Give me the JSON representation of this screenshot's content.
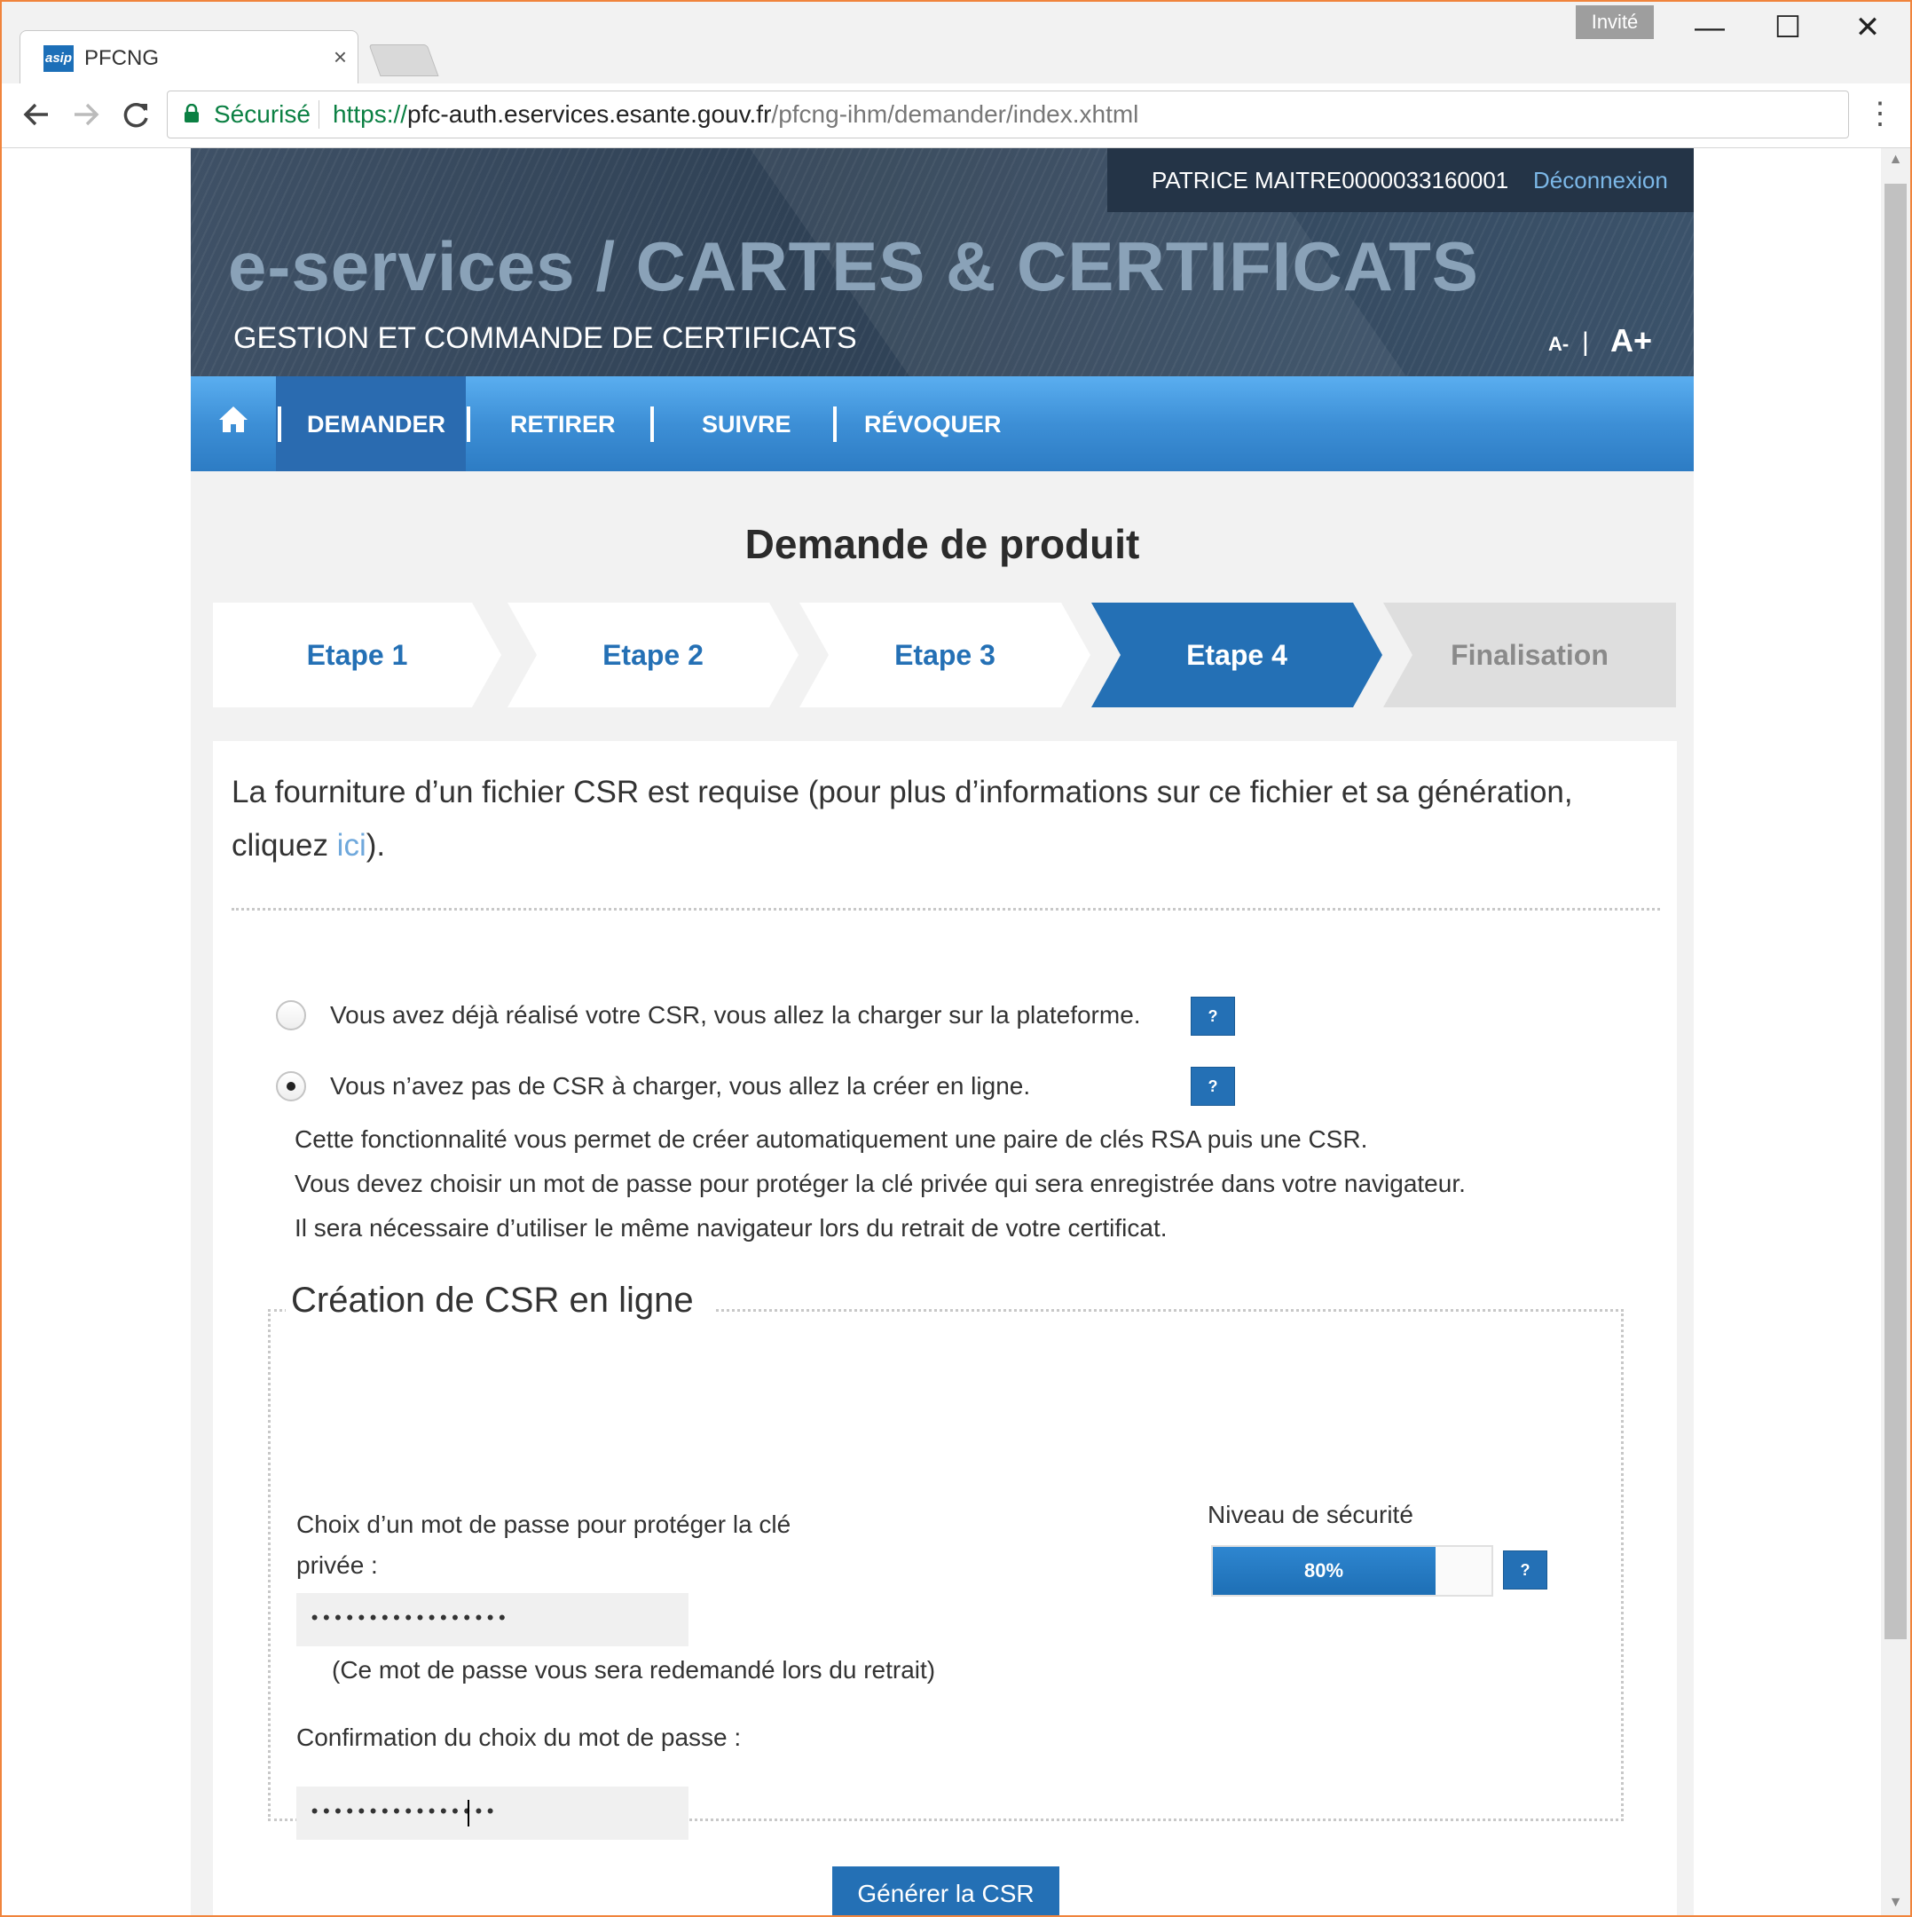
{
  "browser": {
    "tab_title": "PFCNG",
    "tab_favicon_text": "asip",
    "tab_close": "×",
    "guest_label": "Invité",
    "secure_label": "Sécurisé",
    "url_scheme": "https://",
    "url_host": "pfc-auth.eservices.esante.gouv.fr",
    "url_path": "/pfcng-ihm/demander/index.xhtml",
    "window_controls": {
      "minimize": "—",
      "maximize": "☐",
      "close": "✕"
    }
  },
  "header": {
    "user_name": "PATRICE MAITRE0000033160001",
    "logout_label": "Déconnexion",
    "app_title": "e-services / CARTES & CERTIFICATS",
    "app_subtitle": "GESTION ET COMMANDE DE CERTIFICATS",
    "font_decrease": "A-",
    "font_separator": "|",
    "font_increase": "A+"
  },
  "nav": {
    "home_icon": "home-icon",
    "items": [
      {
        "label": "DEMANDER",
        "active": true
      },
      {
        "label": "RETIRER",
        "active": false
      },
      {
        "label": "SUIVRE",
        "active": false
      },
      {
        "label": "RÉVOQUER",
        "active": false
      }
    ]
  },
  "main": {
    "page_title": "Demande de produit",
    "steps": [
      {
        "label": "Etape 1",
        "state": "done"
      },
      {
        "label": "Etape 2",
        "state": "done"
      },
      {
        "label": "Etape 3",
        "state": "done"
      },
      {
        "label": "Etape 4",
        "state": "current"
      },
      {
        "label": "Finalisation",
        "state": "pending"
      }
    ],
    "intro_text_before": "La fourniture d’un fichier CSR est requise (pour plus d’informations sur ce fichier et sa génération, cliquez ",
    "intro_link": "ici",
    "intro_text_after": ").",
    "options": [
      {
        "label": "Vous avez déjà réalisé votre CSR, vous allez la charger sur la plateforme.",
        "checked": false
      },
      {
        "label": "Vous n’avez pas de CSR à charger, vous allez la créer en ligne.",
        "checked": true
      }
    ],
    "help_label": "?",
    "info_lines": [
      "Cette fonctionnalité vous permet de créer automatiquement une paire de clés RSA puis une CSR.",
      "Vous devez choisir un mot de passe pour protéger la clé privée qui sera enregistrée dans votre navigateur.",
      "Il sera nécessaire d’utiliser le même navigateur lors du retrait de votre certificat."
    ],
    "csr_form": {
      "legend": "Création de CSR en ligne",
      "password_label_line1": "Choix d’un mot de passe pour protéger la clé",
      "password_label_line2": "privée :",
      "password_value": "•••••••••••••••••",
      "password_hint": "(Ce mot de passe vous sera redemandé lors du retrait)",
      "confirm_label": "Confirmation du choix du mot de passe :",
      "confirm_value": "••••••••••••••••",
      "security_title": "Niveau de sécurité",
      "security_level": 80,
      "security_level_text": "80%",
      "generate_button": "Générer la CSR"
    }
  },
  "colors": {
    "primary_blue": "#2470b5",
    "nav_blue": "#3d8fd6",
    "header_dark": "#2f4155",
    "link_blue": "#6fa8dc",
    "secure_green": "#0b8043",
    "window_border": "#f0843c"
  }
}
